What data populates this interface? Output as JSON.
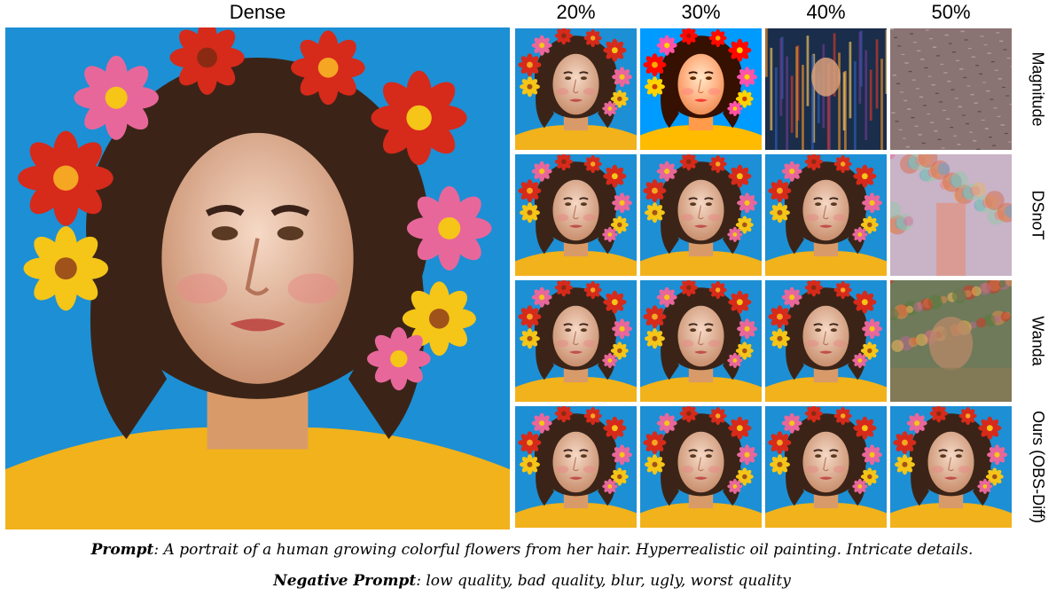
{
  "header": {
    "dense_label": "Dense",
    "sparsity_labels": [
      "20%",
      "30%",
      "40%",
      "50%"
    ]
  },
  "rows": [
    {
      "label": "Magnitude",
      "quality": [
        "good",
        "degraded",
        "glitch",
        "noise"
      ]
    },
    {
      "label": "DSnoT",
      "quality": [
        "good",
        "good",
        "good",
        "washed"
      ]
    },
    {
      "label": "Wanda",
      "quality": [
        "good",
        "good",
        "good",
        "blurred"
      ]
    },
    {
      "label": "Ours (OBS-Diff)",
      "quality": [
        "good",
        "good",
        "good",
        "good"
      ]
    }
  ],
  "prompt": {
    "label": "Prompt",
    "text": ": A portrait of a human growing colorful flowers from her hair. Hyperrealistic oil painting. Intricate details."
  },
  "negative_prompt": {
    "label": "Negative Prompt",
    "text": ": low quality, bad quality, blur, ugly, worst quality"
  },
  "colors": {
    "background_blue": "#1d8fd4",
    "shirt_yellow": "#f1b21c",
    "skin": "#e9bfa3",
    "hair": "#3b2417",
    "flower_red": "#d62a1b",
    "flower_pink": "#e8679b",
    "flower_yellow": "#f5c518"
  }
}
